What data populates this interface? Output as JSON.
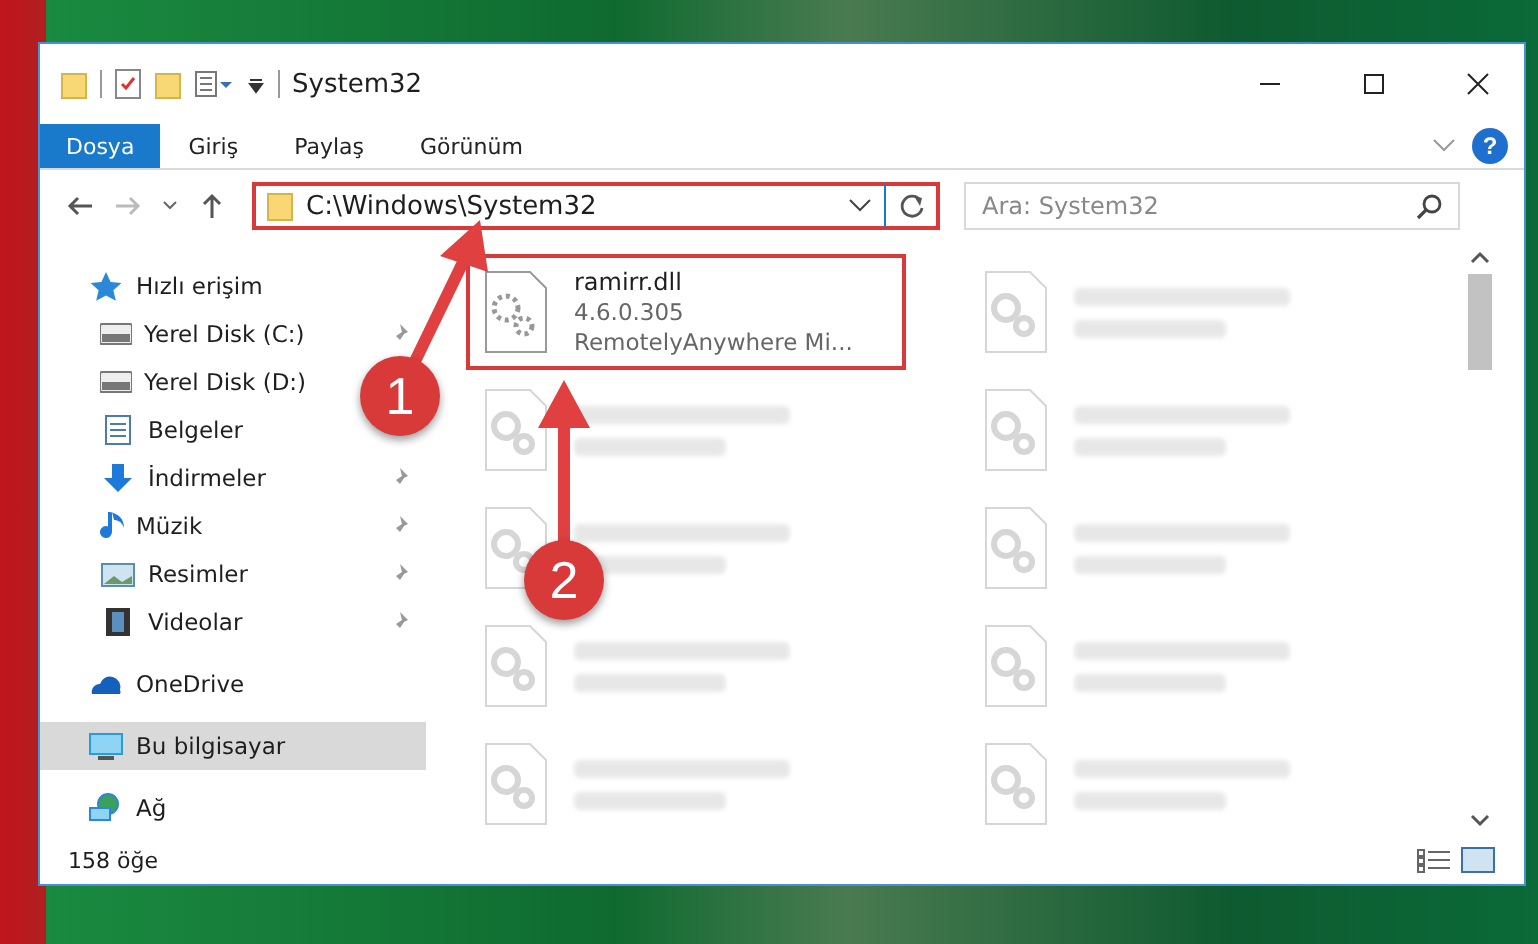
{
  "window": {
    "title": "System32"
  },
  "ribbon_tabs": [
    {
      "label": "Dosya",
      "selected": true
    },
    {
      "label": "Giriş",
      "selected": false
    },
    {
      "label": "Paylaş",
      "selected": false
    },
    {
      "label": "Görünüm",
      "selected": false
    }
  ],
  "address": {
    "value": "C:\\Windows\\System32"
  },
  "search": {
    "placeholder": "Ara: System32"
  },
  "sidebar": {
    "items": [
      {
        "label": "Hızlı erişim",
        "kind": "star",
        "pinned": false,
        "selected": false,
        "children": [
          {
            "label": "Yerel Disk (C:)",
            "kind": "drive",
            "pinned": true,
            "selected": false
          },
          {
            "label": "Yerel Disk (D:)",
            "kind": "drive",
            "pinned": false,
            "selected": false
          },
          {
            "label": "Belgeler",
            "kind": "document",
            "pinned": false,
            "selected": false
          },
          {
            "label": "İndirmeler",
            "kind": "download",
            "pinned": true,
            "selected": false
          },
          {
            "label": "Müzik",
            "kind": "music",
            "pinned": true,
            "selected": false
          },
          {
            "label": "Resimler",
            "kind": "picture",
            "pinned": true,
            "selected": false
          },
          {
            "label": "Videolar",
            "kind": "video",
            "pinned": true,
            "selected": false
          }
        ]
      },
      {
        "label": "OneDrive",
        "kind": "cloud",
        "pinned": false,
        "selected": false
      },
      {
        "label": "Bu bilgisayar",
        "kind": "computer",
        "pinned": false,
        "selected": true
      },
      {
        "label": "Ağ",
        "kind": "network",
        "pinned": false,
        "selected": false
      }
    ]
  },
  "help_button": {
    "label": "?"
  },
  "files": [
    {
      "kind": "file",
      "name": "ramirr.dll",
      "lines": [
        "4.6.0.305",
        "RemotelyAnywhere Mi..."
      ],
      "highlighted": true
    },
    {
      "kind": "blurred"
    },
    {
      "kind": "blurred"
    },
    {
      "kind": "blurred"
    },
    {
      "kind": "blurred"
    },
    {
      "kind": "blurred"
    },
    {
      "kind": "blurred"
    },
    {
      "kind": "blurred"
    },
    {
      "kind": "blurred"
    },
    {
      "kind": "blurred"
    }
  ],
  "status_bar": {
    "count": "158 öğe"
  },
  "annotations": [
    {
      "label": "1"
    },
    {
      "label": "2"
    }
  ]
}
